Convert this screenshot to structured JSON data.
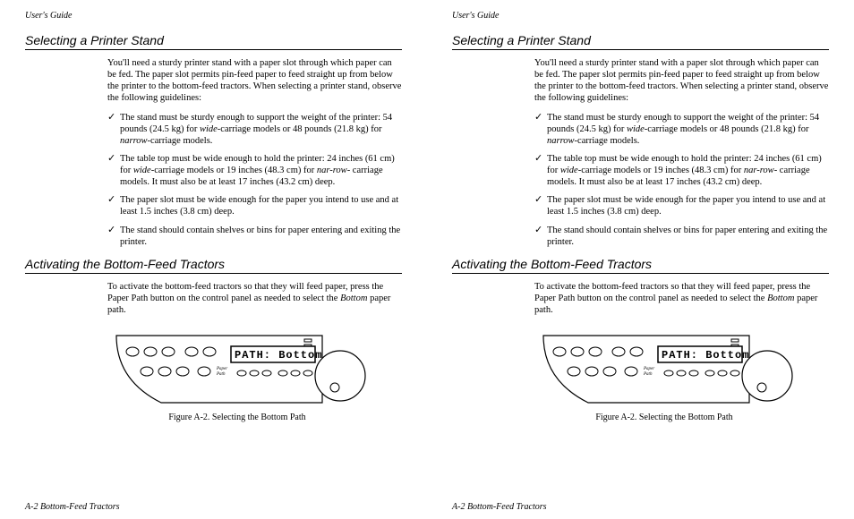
{
  "runHead": "User's Guide",
  "sec1Title": "Selecting a Printer Stand",
  "intro": "You'll need a sturdy printer stand with a paper slot through which paper can be fed.  The paper slot permits pin-feed paper to feed straight up from below the printer to the bottom-feed tractors.  When selecting a printer stand, observe the following guidelines:",
  "bullets": [
    {
      "pre": "The stand must be sturdy enough to support the weight of the printer: 54 pounds (24.5 kg) for ",
      "i1": "wide",
      "mid": "-carriage models or 48 pounds (21.8 kg) for ",
      "i2": "narrow",
      "post": "-carriage models."
    },
    {
      "pre": "The table top must be wide enough to hold the printer:  24 inches (61 cm) for ",
      "i1": "wide",
      "mid": "-carriage models or 19 inches (48.3 cm) for ",
      "i2": "nar-row",
      "post": "- carriage models.  It must also be at least 17 inches (43.2 cm) deep."
    },
    {
      "pre": "The paper slot must be wide enough for the paper you intend to use and at least 1.5 inches (3.8 cm) deep.",
      "i1": "",
      "mid": "",
      "i2": "",
      "post": ""
    },
    {
      "pre": "The stand should contain shelves or bins for paper entering and exiting the printer.",
      "i1": "",
      "mid": "",
      "i2": "",
      "post": ""
    }
  ],
  "sec2Title": "Activating the Bottom-Feed Tractors",
  "actPara": {
    "pre": "To activate the bottom-feed tractors so that they will feed paper, press the Paper Path button on the control panel as needed to select the ",
    "i": "Bottom",
    "post": " paper path."
  },
  "panel": {
    "label": "Paper\nPath",
    "lcd": "PATH:  Bottom"
  },
  "figCaption": "Figure A-2.  Selecting the Bottom Path",
  "footer": "A-2 Bottom-Feed Tractors"
}
